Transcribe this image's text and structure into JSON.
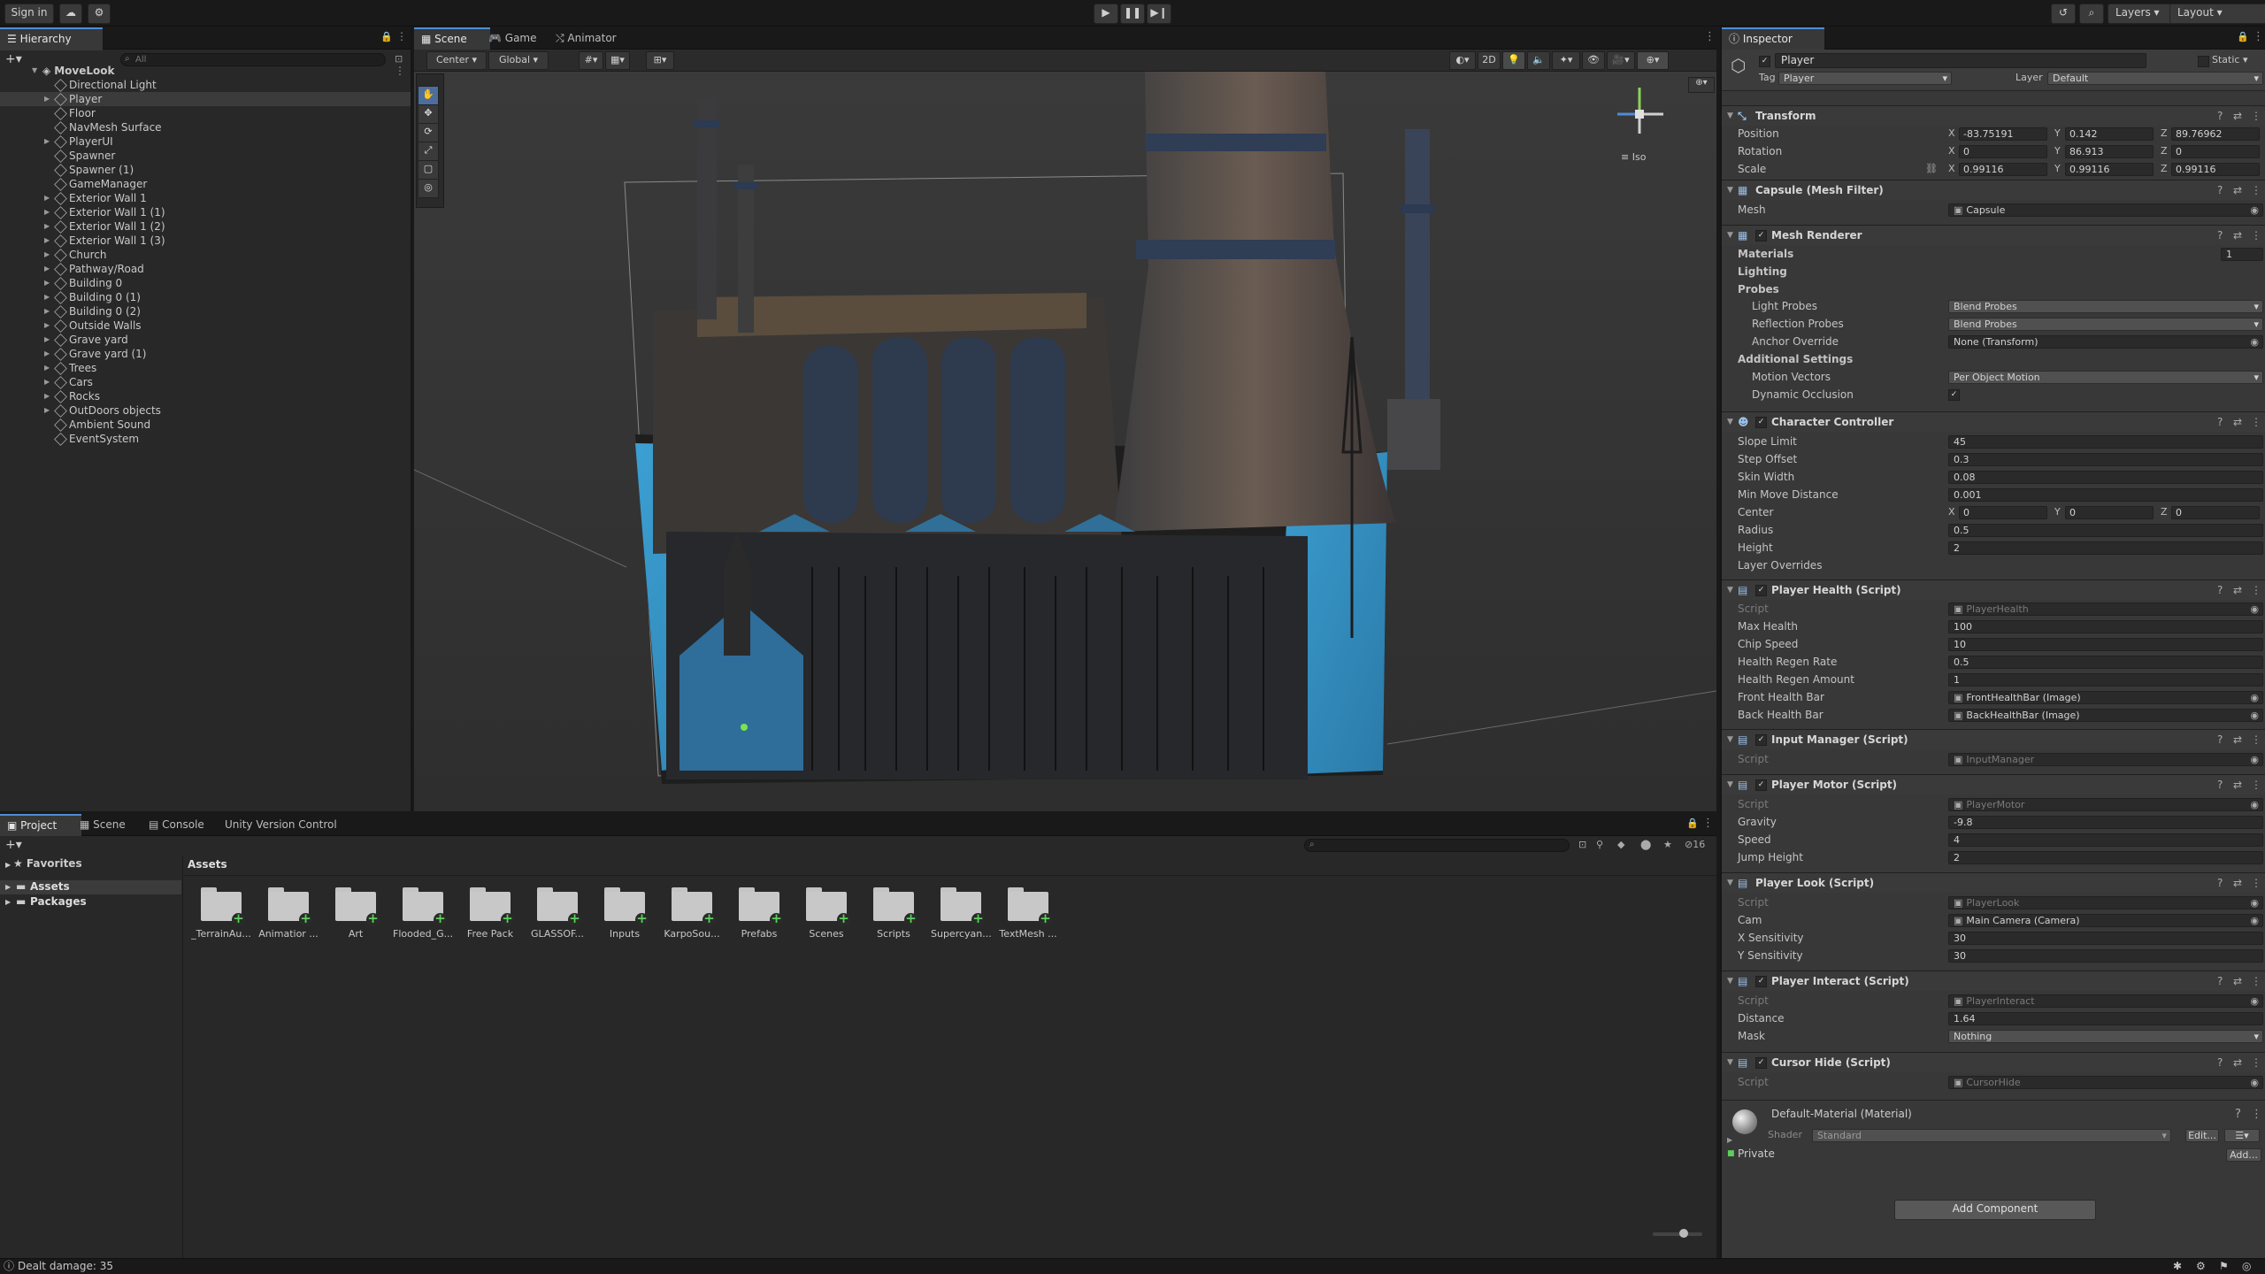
{
  "top_bar": {
    "sign_in": "Sign in",
    "layers": "Layers",
    "layout": "Layout"
  },
  "hierarchy": {
    "tab": "Hierarchy",
    "search_placeholder": "All",
    "scene_name": "MoveLook",
    "items": [
      {
        "label": "Directional Light",
        "expandable": false
      },
      {
        "label": "Player",
        "expandable": true,
        "selected": true
      },
      {
        "label": "Floor",
        "expandable": false
      },
      {
        "label": "NavMesh Surface",
        "expandable": false
      },
      {
        "label": "PlayerUI",
        "expandable": true
      },
      {
        "label": "Spawner",
        "expandable": false
      },
      {
        "label": "Spawner (1)",
        "expandable": false
      },
      {
        "label": "GameManager",
        "expandable": false
      },
      {
        "label": "Exterior Wall 1",
        "expandable": true
      },
      {
        "label": "Exterior Wall 1 (1)",
        "expandable": true
      },
      {
        "label": "Exterior Wall 1 (2)",
        "expandable": true
      },
      {
        "label": "Exterior Wall 1 (3)",
        "expandable": true
      },
      {
        "label": "Church",
        "expandable": true
      },
      {
        "label": "Pathway/Road",
        "expandable": true
      },
      {
        "label": "Building 0",
        "expandable": true
      },
      {
        "label": "Building 0  (1)",
        "expandable": true
      },
      {
        "label": "Building 0  (2)",
        "expandable": true
      },
      {
        "label": "Outside Walls",
        "expandable": true
      },
      {
        "label": "Grave yard",
        "expandable": true
      },
      {
        "label": "Grave yard (1)",
        "expandable": true
      },
      {
        "label": "Trees",
        "expandable": true
      },
      {
        "label": "Cars",
        "expandable": true
      },
      {
        "label": "Rocks",
        "expandable": true
      },
      {
        "label": "OutDoors objects",
        "expandable": true
      },
      {
        "label": "Ambient Sound",
        "expandable": false
      },
      {
        "label": "EventSystem",
        "expandable": false
      }
    ]
  },
  "scene_view": {
    "tabs": [
      "Scene",
      "Game",
      "Animator"
    ],
    "pivot": "Center",
    "space": "Global",
    "mode_2d": "2D",
    "gizmo_label": "Iso"
  },
  "inspector": {
    "tab": "Inspector",
    "object_name": "Player",
    "static_label": "Static",
    "tag_label": "Tag",
    "tag_value": "Player",
    "layer_label": "Layer",
    "layer_value": "Default",
    "transform": {
      "title": "Transform",
      "position": {
        "label": "Position",
        "x": "-83.75191",
        "y": "0.142",
        "z": "89.76962"
      },
      "rotation": {
        "label": "Rotation",
        "x": "0",
        "y": "86.913",
        "z": "0"
      },
      "scale": {
        "label": "Scale",
        "x": "0.99116",
        "y": "0.99116",
        "z": "0.99116"
      }
    },
    "mesh_filter": {
      "title": "Capsule (Mesh Filter)",
      "mesh_label": "Mesh",
      "mesh_value": "Capsule"
    },
    "mesh_renderer": {
      "title": "Mesh Renderer",
      "materials": "Materials",
      "materials_count": "1",
      "lighting": "Lighting",
      "probes": "Probes",
      "light_probes_label": "Light Probes",
      "light_probes": "Blend Probes",
      "reflection_probes_label": "Reflection Probes",
      "reflection_probes": "Blend Probes",
      "anchor_override_label": "Anchor Override",
      "anchor_override": "None (Transform)",
      "additional": "Additional Settings",
      "motion_vectors_label": "Motion Vectors",
      "motion_vectors": "Per Object Motion",
      "dynamic_occlusion_label": "Dynamic Occlusion"
    },
    "character_controller": {
      "title": "Character Controller",
      "slope_limit_label": "Slope Limit",
      "slope_limit": "45",
      "step_offset_label": "Step Offset",
      "step_offset": "0.3",
      "skin_width_label": "Skin Width",
      "skin_width": "0.08",
      "min_move_label": "Min Move Distance",
      "min_move": "0.001",
      "center_label": "Center",
      "center_x": "0",
      "center_y": "0",
      "center_z": "0",
      "radius_label": "Radius",
      "radius": "0.5",
      "height_label": "Height",
      "height": "2",
      "layer_overrides": "Layer Overrides"
    },
    "player_health": {
      "title": "Player Health (Script)",
      "script_label": "Script",
      "script": "PlayerHealth",
      "max_health_label": "Max Health",
      "max_health": "100",
      "chip_speed_label": "Chip Speed",
      "chip_speed": "10",
      "regen_rate_label": "Health Regen Rate",
      "regen_rate": "0.5",
      "regen_amount_label": "Health Regen Amount",
      "regen_amount": "1",
      "front_bar_label": "Front Health Bar",
      "front_bar": "FrontHealthBar (Image)",
      "back_bar_label": "Back Health Bar",
      "back_bar": "BackHealthBar (Image)"
    },
    "input_manager": {
      "title": "Input Manager (Script)",
      "script_label": "Script",
      "script": "InputManager"
    },
    "player_motor": {
      "title": "Player Motor (Script)",
      "script_label": "Script",
      "script": "PlayerMotor",
      "gravity_label": "Gravity",
      "gravity": "-9.8",
      "speed_label": "Speed",
      "speed": "4",
      "jump_label": "Jump Height",
      "jump": "2"
    },
    "player_look": {
      "title": "Player Look (Script)",
      "script_label": "Script",
      "script": "PlayerLook",
      "cam_label": "Cam",
      "cam": "Main Camera (Camera)",
      "x_sens_label": "X Sensitivity",
      "x_sens": "30",
      "y_sens_label": "Y Sensitivity",
      "y_sens": "30"
    },
    "player_interact": {
      "title": "Player Interact (Script)",
      "script_label": "Script",
      "script": "PlayerInteract",
      "distance_label": "Distance",
      "distance": "1.64",
      "mask_label": "Mask",
      "mask": "Nothing"
    },
    "cursor_hide": {
      "title": "Cursor Hide (Script)",
      "script_label": "Script",
      "script": "CursorHide"
    },
    "material": {
      "name": "Default-Material (Material)",
      "shader_label": "Shader",
      "shader": "Standard",
      "edit": "Edit...",
      "private": "Private",
      "add": "Add..."
    },
    "add_component": "Add Component"
  },
  "project": {
    "tabs": [
      "Project",
      "Scene",
      "Console",
      "Unity Version Control"
    ],
    "favorites": "Favorites",
    "tree": [
      "Assets",
      "Packages"
    ],
    "breadcrumb": "Assets",
    "hidden_count": "16",
    "folders": [
      "_TerrainAu...",
      "Animatior ...",
      "Art",
      "Flooded_G...",
      "Free Pack",
      "GLASSOF...",
      "Inputs",
      "KarpoSou...",
      "Prefabs",
      "Scenes",
      "Scripts",
      "Supercyan...",
      "TextMesh ..."
    ]
  },
  "status": {
    "message": "Dealt damage: 35"
  },
  "colors": {
    "accent": "#4e8dd6",
    "selection": "#3b3b3b",
    "water": "#3f9fd0"
  }
}
